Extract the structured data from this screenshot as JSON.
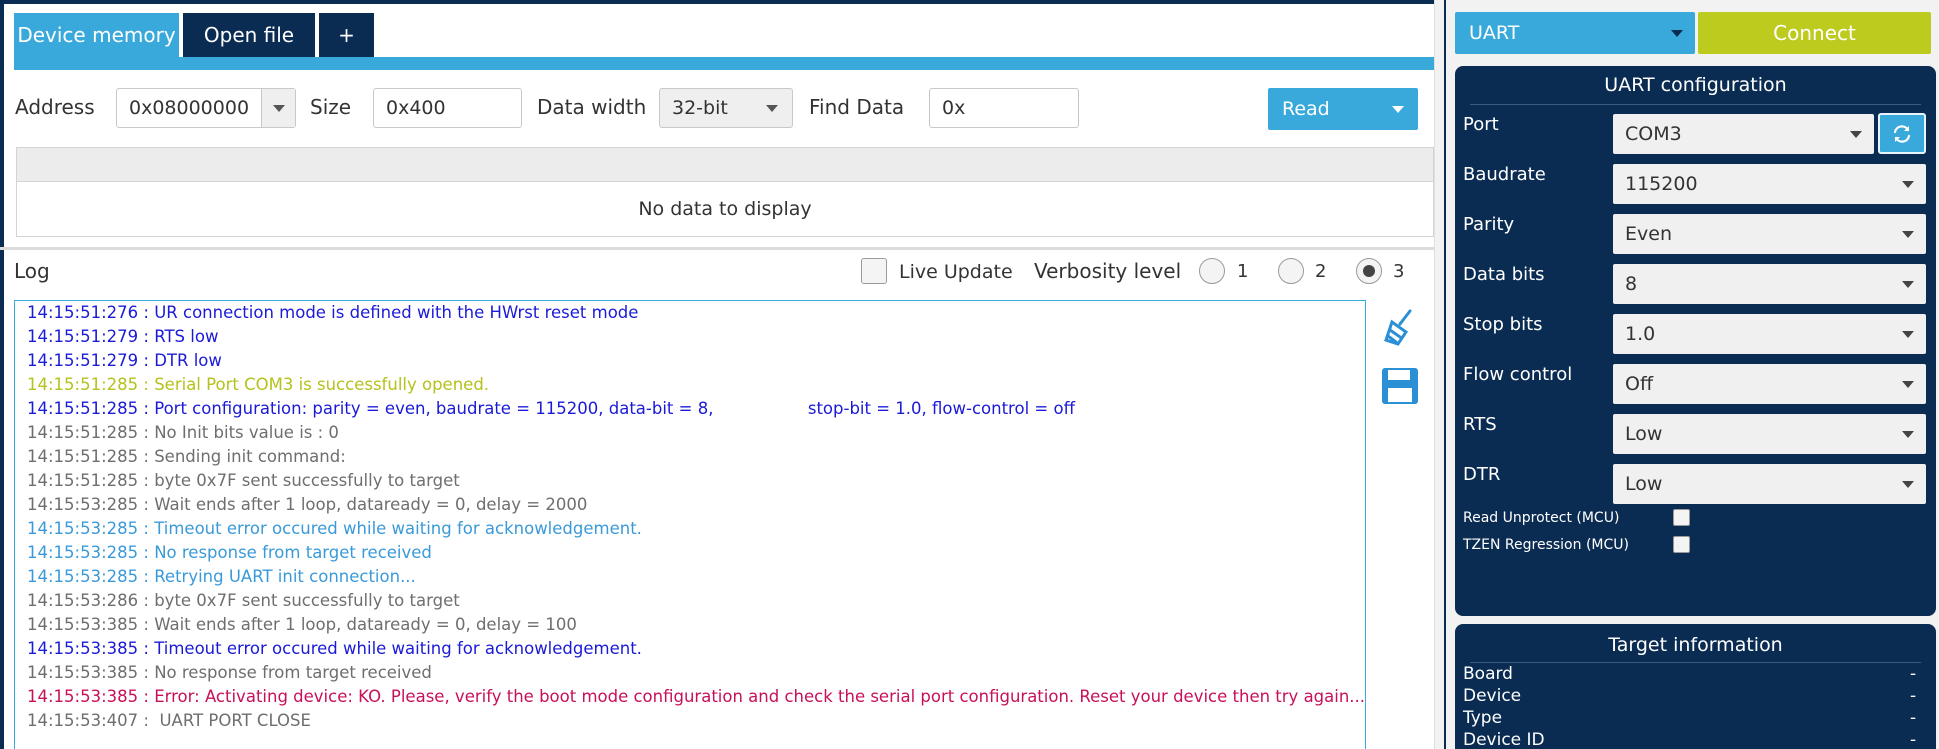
{
  "tabs": {
    "device_memory": "Device memory",
    "open_file": "Open file",
    "add": "+"
  },
  "toolbar": {
    "address_label": "Address",
    "address_value": "0x08000000",
    "size_label": "Size",
    "size_value": "0x400",
    "data_width_label": "Data width",
    "data_width_value": "32-bit",
    "find_data_label": "Find Data",
    "find_data_value": "0x",
    "read_label": "Read"
  },
  "grid": {
    "empty_message": "No data to display"
  },
  "log": {
    "title": "Log",
    "live_update_label": "Live Update",
    "live_update_checked": false,
    "verbosity_label": "Verbosity level",
    "verbosity_options": [
      "1",
      "2",
      "3"
    ],
    "verbosity_selected": "3",
    "colors": {
      "blue": "#1a1ad8",
      "yellow": "#b5c21b",
      "gray": "#6e6e6e",
      "lightblue": "#3a9ad9",
      "red": "#c8105a"
    },
    "lines": [
      {
        "text": "14:15:51:276 : UR connection mode is defined with the HWrst reset mode",
        "color": "blue"
      },
      {
        "text": "14:15:51:279 : RTS low",
        "color": "blue"
      },
      {
        "text": "14:15:51:279 : DTR low",
        "color": "blue"
      },
      {
        "text": "14:15:51:285 : Serial Port COM3 is successfully opened.",
        "color": "yellow"
      },
      {
        "text": "14:15:51:285 : Port configuration: parity = even, baudrate = 115200, data-bit = 8,                  stop-bit = 1.0, flow-control = off",
        "color": "blue"
      },
      {
        "text": "14:15:51:285 : No Init bits value is : 0",
        "color": "gray"
      },
      {
        "text": "14:15:51:285 : Sending init command:",
        "color": "gray"
      },
      {
        "text": "14:15:51:285 : byte 0x7F sent successfully to target",
        "color": "gray"
      },
      {
        "text": "14:15:53:285 : Wait ends after 1 loop, dataready = 0, delay = 2000",
        "color": "gray"
      },
      {
        "text": "14:15:53:285 : Timeout error occured while waiting for acknowledgement.",
        "color": "lightblue"
      },
      {
        "text": "14:15:53:285 : No response from target received",
        "color": "lightblue"
      },
      {
        "text": "14:15:53:285 : Retrying UART init connection...",
        "color": "lightblue"
      },
      {
        "text": "14:15:53:286 : byte 0x7F sent successfully to target",
        "color": "gray"
      },
      {
        "text": "14:15:53:385 : Wait ends after 1 loop, dataready = 0, delay = 100",
        "color": "gray"
      },
      {
        "text": "14:15:53:385 : Timeout error occured while waiting for acknowledgement.",
        "color": "blue"
      },
      {
        "text": "14:15:53:385 : No response from target received",
        "color": "gray"
      },
      {
        "text": "14:15:53:385 : Error: Activating device: KO. Please, verify the boot mode configuration and check the serial port configuration. Reset your device then try again...",
        "color": "red"
      },
      {
        "text": "14:15:53:407 :  UART PORT CLOSE",
        "color": "gray"
      }
    ]
  },
  "connection": {
    "interface_value": "UART",
    "connect_label": "Connect"
  },
  "uart_config": {
    "title": "UART configuration",
    "port_label": "Port",
    "port_value": "COM3",
    "baudrate_label": "Baudrate",
    "baudrate_value": "115200",
    "parity_label": "Parity",
    "parity_value": "Even",
    "data_bits_label": "Data bits",
    "data_bits_value": "8",
    "stop_bits_label": "Stop bits",
    "stop_bits_value": "1.0",
    "flow_control_label": "Flow control",
    "flow_control_value": "Off",
    "rts_label": "RTS",
    "rts_value": "Low",
    "dtr_label": "DTR",
    "dtr_value": "Low",
    "read_unprotect_label": "Read Unprotect (MCU)",
    "read_unprotect_checked": false,
    "tzen_regression_label": "TZEN Regression (MCU)",
    "tzen_regression_checked": false
  },
  "target_info": {
    "title": "Target information",
    "board_label": "Board",
    "board_value": "-",
    "device_label": "Device",
    "device_value": "-",
    "type_label": "Type",
    "type_value": "-",
    "device_id_label": "Device ID",
    "device_id_value": "-"
  },
  "icons": {
    "clear_log": "broom-icon",
    "save_log": "floppy-disk-icon",
    "refresh": "refresh-icon"
  },
  "theme": {
    "navy": "#0b2c52",
    "accent_blue": "#39a9db",
    "connect_green": "#bccb1e"
  }
}
